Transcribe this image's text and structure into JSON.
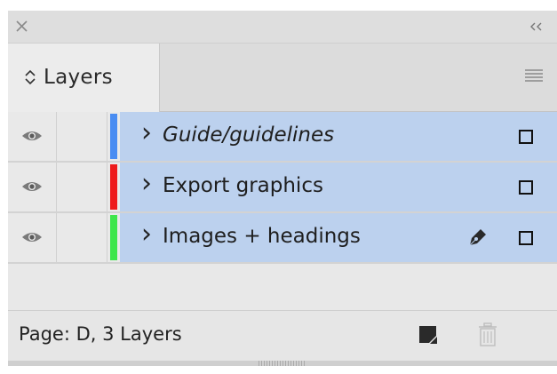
{
  "panel": {
    "tab_label": "Layers",
    "tab_arrow_glyph": "◇"
  },
  "layers": [
    {
      "name": "Guide/guidelines",
      "color": "#4a8df2",
      "visible": true,
      "italic": true,
      "has_pen": false
    },
    {
      "name": "Export graphics",
      "color": "#ee1b1b",
      "visible": true,
      "italic": false,
      "has_pen": false
    },
    {
      "name": "Images + headings",
      "color": "#3ee64a",
      "visible": true,
      "italic": false,
      "has_pen": true
    }
  ],
  "footer": {
    "status": "Page: D, 3 Layers"
  },
  "icons": {
    "close": "close-icon",
    "collapse": "collapse-icon",
    "panel_menu": "menu-icon",
    "visibility": "eye-icon",
    "expand": "chevron-right-icon",
    "current_drawing_layer": "pen-icon",
    "new_layer": "new-layer-icon",
    "delete": "trash-icon"
  },
  "colors": {
    "selected_row": "#bcd1ee"
  }
}
